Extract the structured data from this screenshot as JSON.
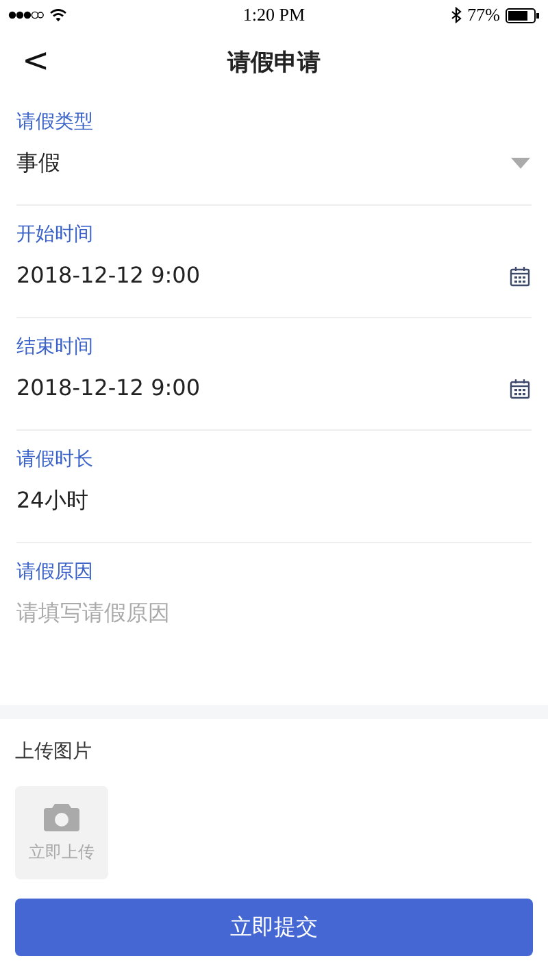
{
  "status_bar": {
    "time": "1:20 PM",
    "battery_percent": "77%"
  },
  "nav": {
    "back": "<",
    "title": "请假申请"
  },
  "fields": [
    {
      "kind": "select",
      "label": "请假类型",
      "value": "事假"
    },
    {
      "kind": "date",
      "label": "开始时间",
      "value": "2018-12-12 9:00"
    },
    {
      "kind": "date",
      "label": "结束时间",
      "value": "2018-12-12 9:00"
    },
    {
      "kind": "text",
      "label": "请假时长",
      "value": "24小时"
    },
    {
      "kind": "textarea",
      "label": "请假原因",
      "placeholder": "请填写请假原因"
    }
  ],
  "upload": {
    "label": "上传图片",
    "button": "立即上传"
  },
  "submit": "立即提交"
}
